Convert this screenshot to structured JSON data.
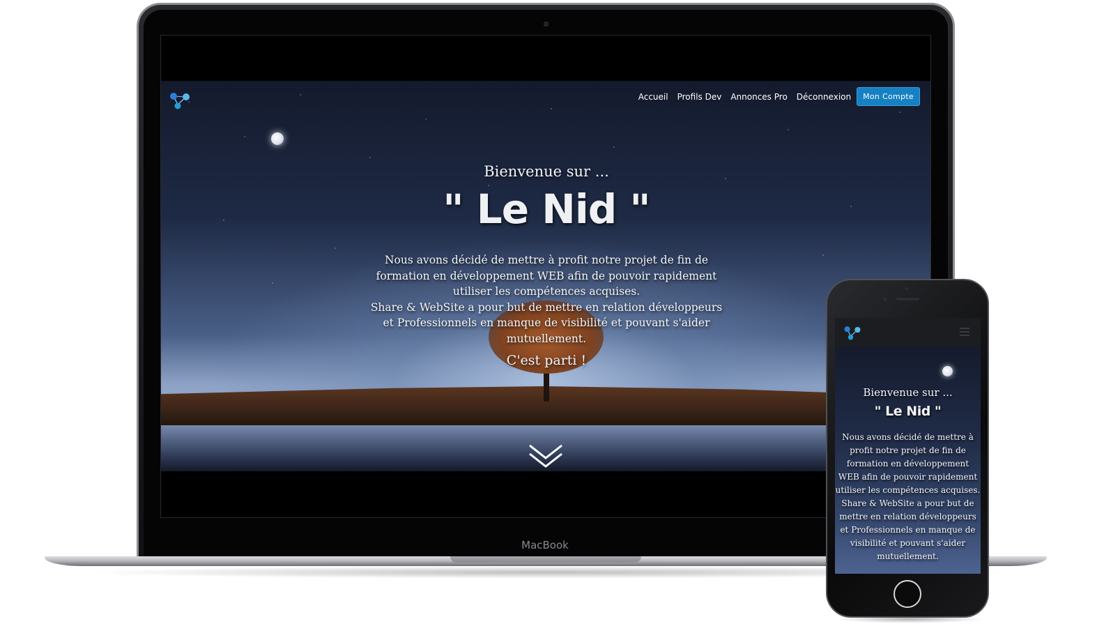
{
  "desktop": {
    "nav": {
      "links": [
        "Accueil",
        "Profils Dev",
        "Annonces Pro",
        "Déconnexion"
      ],
      "cta_label": "Mon Compte",
      "cta_color": "#1681c2"
    },
    "hero": {
      "welcome": "Bienvenue sur ...",
      "title": "\" Le Nid \"",
      "description_lines": [
        "Nous avons décidé de mettre à profit notre projet de fin de",
        "formation en développement WEB afin de pouvoir rapidement",
        "utiliser les compétences acquises.",
        "Share & WebSite a pour but de mettre en relation développeurs",
        "et Professionnels en manque de visibilité et pouvant s'aider",
        "mutuellement."
      ],
      "cta_text": "C'est parti !",
      "scroll_icon": "double-chevron-down-icon"
    }
  },
  "device_label": "MacBook",
  "mobile": {
    "menu_icon": "hamburger-menu-icon",
    "hero": {
      "welcome": "Bienvenue sur ...",
      "title": "\" Le Nid \"",
      "description_lines": [
        "Nous avons décidé de mettre à",
        "profit notre projet de fin de",
        "formation en développement",
        "WEB afin de pouvoir rapidement",
        "utiliser les compétences acquises.",
        "Share & WebSite a pour but de",
        "mettre en relation développeurs",
        "et Professionnels en manque de",
        "visibilité et pouvant s'aider",
        "mutuellement."
      ]
    }
  },
  "logo_icon": "molecule-logo-icon",
  "colors": {
    "accent": "#1681c2",
    "logo_blue": "#2a7fd4",
    "logo_cyan": "#5ab8e8"
  }
}
